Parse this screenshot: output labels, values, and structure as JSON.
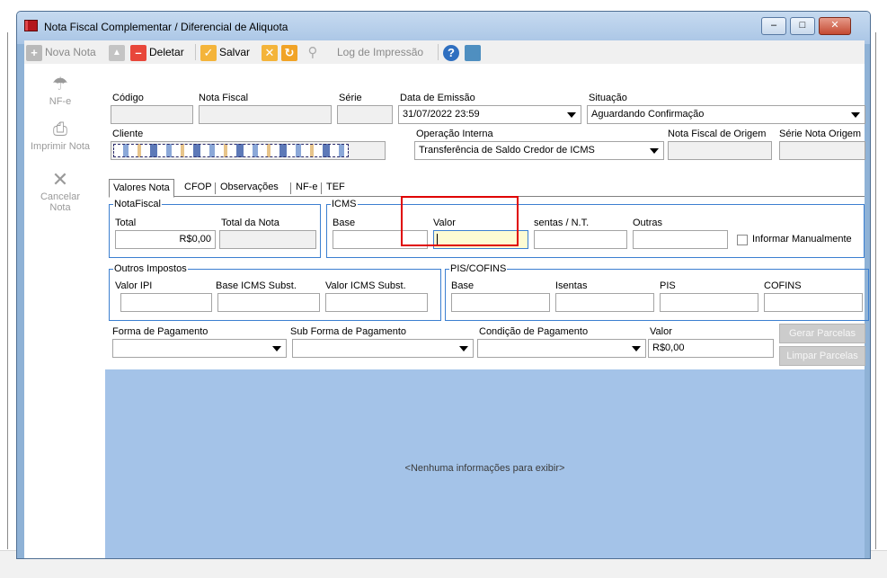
{
  "window": {
    "title": "Nota Fiscal Complementar / Diferencial de Aliquota"
  },
  "toolbar": {
    "nova_nota": "Nova Nota",
    "deletar": "Deletar",
    "salvar": "Salvar",
    "log_impressao": "Log de Impressão"
  },
  "sidebar": {
    "nfe": "NF-e",
    "imprimir": "Imprimir Nota",
    "cancelar_l1": "Cancelar",
    "cancelar_l2": "Nota"
  },
  "header": {
    "codigo_label": "Código",
    "nota_fiscal_label": "Nota Fiscal",
    "serie_label": "Série",
    "data_emissao_label": "Data de Emissão",
    "data_emissao_value": "31/07/2022 23:59",
    "situacao_label": "Situação",
    "situacao_value": "Aguardando Confirmação",
    "cliente_label": "Cliente",
    "operacao_label": "Operação Interna",
    "operacao_value": "Transferência de Saldo Credor de ICMS",
    "nf_origem_label": "Nota Fiscal de Origem",
    "serie_origem_label": "Série Nota Origem"
  },
  "tabs": [
    "Valores Nota",
    "CFOP",
    "Observações",
    "NF-e",
    "TEF"
  ],
  "notafiscal": {
    "legend": "NotaFiscal",
    "total_label": "Total",
    "total_value": "R$0,00",
    "total_nota_label": "Total da Nota"
  },
  "icms": {
    "legend": "ICMS",
    "base_label": "Base",
    "valor_label": "Valor",
    "isentas_label": "sentas / N.T.",
    "outras_label": "Outras",
    "informar_label": "Informar Manualmente"
  },
  "outros": {
    "legend": "Outros Impostos",
    "ipi_label": "Valor IPI",
    "base_st_label": "Base ICMS Subst.",
    "valor_st_label": "Valor ICMS Subst."
  },
  "pis": {
    "legend": "PIS/COFINS",
    "base_label": "Base",
    "isentas_label": "Isentas",
    "pis_label": "PIS",
    "cofins_label": "COFINS"
  },
  "pagamento": {
    "forma_label": "Forma de Pagamento",
    "sub_label": "Sub Forma de Pagamento",
    "condicao_label": "Condição de Pagamento",
    "valor_label": "Valor",
    "valor_value": "R$0,00",
    "gerar": "Gerar Parcelas",
    "limpar": "Limpar Parcelas"
  },
  "grid": {
    "empty_message": "<Nenhuma informações para exibir>"
  },
  "colors": {
    "accent": "#3c7fd0",
    "grid_bg": "#a4c3e8",
    "highlight": "#e00000",
    "focus_field": "#fdfbd3"
  }
}
